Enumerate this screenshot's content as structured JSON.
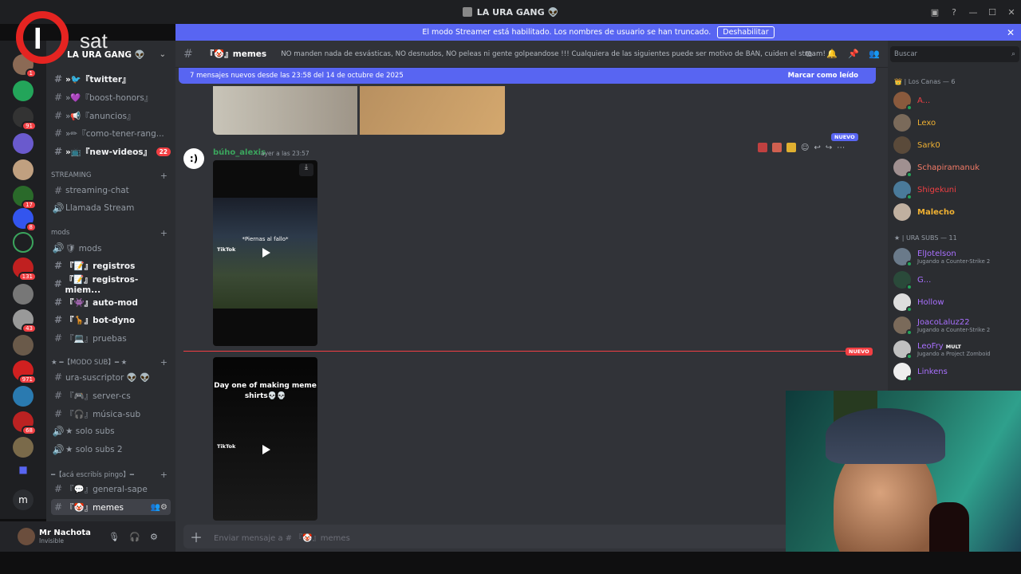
{
  "window": {
    "title": "LA URA GANG 👽"
  },
  "streamer": {
    "message": "El modo Streamer está habilitado. Los nombres de usuario se han truncado.",
    "button": "Deshabilitar"
  },
  "logo": {
    "text": "sat",
    "initial": "I"
  },
  "server": {
    "name": "LA URA GANG 👽"
  },
  "server_badges": [
    "1",
    "91",
    "17",
    "8",
    "131",
    "43",
    "971",
    "68"
  ],
  "channels": [
    {
      "prefix": "#",
      "label": "»🐦『twitter』",
      "bold": true
    },
    {
      "prefix": "#",
      "label": "»💜『boost-honors』",
      "bold": false
    },
    {
      "prefix": "#",
      "label": "»📢『anuncios』",
      "bold": false
    },
    {
      "prefix": "#",
      "label": "»✏『como-tener-rang...",
      "bold": false
    },
    {
      "prefix": "#",
      "label": "»📺『new-videos』",
      "bold": true,
      "pill": "22"
    }
  ],
  "categories": {
    "streaming": "STREAMING",
    "mods": "mods",
    "modo_sub": "★ ━【MODO SUB】━ ★",
    "aca": "━【acá escribís pingo】━"
  },
  "streaming_channels": [
    {
      "prefix": "#",
      "label": "streaming-chat"
    },
    {
      "prefix": "🔊",
      "label": "Llamada Stream"
    }
  ],
  "mods_channels": [
    {
      "prefix": "🔊",
      "label": "🛡 mods",
      "bold": false
    },
    {
      "prefix": "#",
      "label": "『📝』registros",
      "bold": true
    },
    {
      "prefix": "#",
      "label": "『📝』registros-miem...",
      "bold": true
    },
    {
      "prefix": "#",
      "label": "『👾』auto-mod",
      "bold": true
    },
    {
      "prefix": "#",
      "label": "『🦒』bot-dyno",
      "bold": true
    },
    {
      "prefix": "#",
      "label": "『💻』pruebas",
      "bold": false
    }
  ],
  "sub_channels": [
    {
      "prefix": "#",
      "label": "ura-suscriptor 👽 👽"
    },
    {
      "prefix": "#",
      "label": "『🎮』server-cs"
    },
    {
      "prefix": "#",
      "label": "『🎧』música-sub"
    },
    {
      "prefix": "🔊",
      "label": "★ solo subs"
    },
    {
      "prefix": "🔊",
      "label": "★ solo subs 2"
    }
  ],
  "aca_channels": [
    {
      "prefix": "#",
      "label": "『💬』general-sape"
    },
    {
      "prefix": "#",
      "label": "『🤡』memes"
    }
  ],
  "user": {
    "name": "Mr Nachota",
    "status": "Invisible"
  },
  "header": {
    "channel": "『🤡』memes",
    "topic": "NO manden nada de esvásticas, NO desnudos, NO peleas ni gente golpeandose !!! Cualquiera de las siguientes puede ser motivo de BAN, cuiden el stream!"
  },
  "newbar": {
    "text": "7 mensajes nuevos desde las 23:58 del 14 de octubre de 2025",
    "mark": "Marcar como leído"
  },
  "message": {
    "author": "búho_alexis",
    "time": "ayer a las 23:57",
    "avatar_text": ":)",
    "nuevo": "NUEVO"
  },
  "video1": {
    "caption": "*Piernas al fallo*",
    "brand": "TikTok"
  },
  "video2": {
    "text": "Day one of making meme shirts💀💀",
    "brand": "TikTok"
  },
  "divider_label": "NUEVO",
  "composer": {
    "placeholder": "Enviar mensaje a # 『🤡』memes"
  },
  "search": {
    "placeholder": "Buscar"
  },
  "members": {
    "cat1": "👑 | Los Canas — 6",
    "group1": [
      {
        "name": "A...",
        "color": "#f23f43",
        "avatar": "#8a5a3d"
      },
      {
        "name": "Lexo",
        "color": "#f0b132",
        "avatar": "#7a6a5a"
      },
      {
        "name": "Sark0",
        "color": "#f0b132",
        "avatar": "#5a4a3a"
      },
      {
        "name": "Schapiramanuk",
        "color": "#f47b67",
        "avatar": "#a09090"
      },
      {
        "name": "Shigekuni",
        "color": "#f23f43",
        "avatar": "#4a7a9a"
      },
      {
        "name": "Malecho",
        "color": "#f0b132",
        "avatar": "#c0b0a0"
      }
    ],
    "cat2": "★ | URA SUBS — 11",
    "group2": [
      {
        "name": "ElJotelson",
        "color": "#a970ff",
        "activity": "Jugando a Counter-Strike 2",
        "avatar": "#6a7a8a"
      },
      {
        "name": "G...",
        "color": "#a970ff",
        "activity": "",
        "avatar": "#2a4a3a"
      },
      {
        "name": "Hollow",
        "color": "#a970ff",
        "activity": "",
        "avatar": "#dddddd"
      },
      {
        "name": "JoacoLaluz22",
        "color": "#a970ff",
        "activity": "Jugando a Counter-Strike 2",
        "avatar": "#7a6a5a"
      },
      {
        "name": "LeoFry",
        "color": "#a970ff",
        "activity": "Jugando a Project Zomboid",
        "tag": "MULT",
        "avatar": "#c0c0c0"
      },
      {
        "name": "Linkens",
        "color": "#a970ff",
        "activity": "",
        "avatar": "#eeeeee"
      }
    ]
  }
}
